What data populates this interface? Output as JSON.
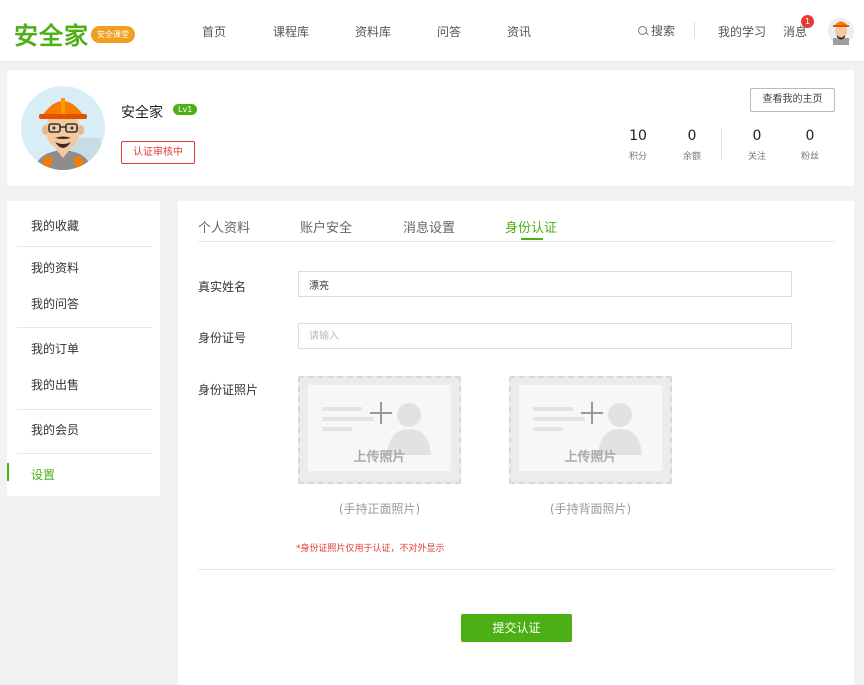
{
  "header": {
    "logo": "安全家",
    "logo_badge": "安全课堂",
    "nav": [
      "首页",
      "课程库",
      "资料库",
      "问答",
      "资讯"
    ],
    "search_label": "搜索",
    "my_study": "我的学习",
    "messages": "消息",
    "message_count": "1"
  },
  "profile": {
    "name": "安全家",
    "level": "Lv1",
    "cert_status": "认证审核中",
    "view_home": "查看我的主页",
    "stats": [
      {
        "value": "10",
        "label": "积分"
      },
      {
        "value": "0",
        "label": "余额"
      },
      {
        "value": "0",
        "label": "关注"
      },
      {
        "value": "0",
        "label": "粉丝"
      }
    ]
  },
  "sidebar": {
    "items": [
      "我的收藏",
      "我的资料",
      "我的问答",
      "我的订单",
      "我的出售",
      "我的会员",
      "设置"
    ]
  },
  "tabs": [
    "个人资料",
    "账户安全",
    "消息设置",
    "身份认证"
  ],
  "form": {
    "real_name_label": "真实姓名",
    "real_name_value": "漂亮",
    "id_number_label": "身份证号",
    "id_number_placeholder": "请输入",
    "id_photo_label": "身份证照片",
    "upload_text": "上传照片",
    "front_caption": "(手持正面照片)",
    "back_caption": "(手持背面照片)",
    "note": "*身份证照片仅用于认证，不对外显示",
    "submit": "提交认证"
  },
  "colors": {
    "brand_green": "#4caf14",
    "alert_red": "#e53935",
    "badge_orange": "#f0a020"
  }
}
